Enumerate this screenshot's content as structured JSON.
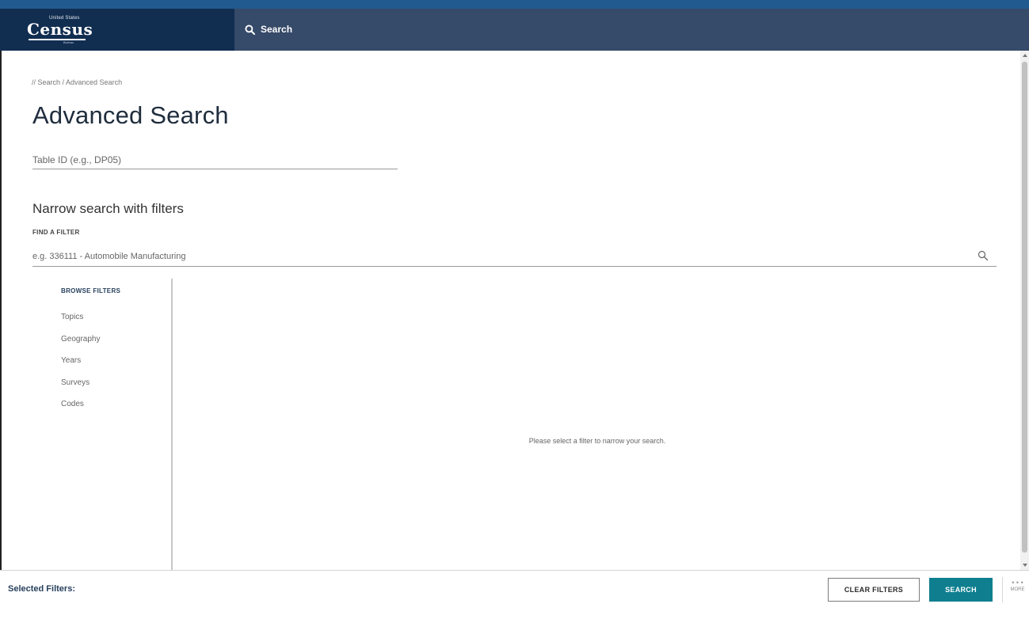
{
  "header": {
    "logo": {
      "sup": "United States",
      "word": "Census",
      "sub": "Bureau"
    },
    "search_label": "Search"
  },
  "breadcrumb": "// Search / Advanced Search",
  "page_title": "Advanced Search",
  "table_id": {
    "placeholder": "Table ID (e.g., DP05)",
    "value": ""
  },
  "narrow_heading": "Narrow search with filters",
  "find_filter": {
    "label": "FIND A FILTER",
    "placeholder": "e.g. 336111 - Automobile Manufacturing",
    "value": ""
  },
  "browse": {
    "title": "BROWSE FILTERS",
    "items": [
      {
        "label": "Topics"
      },
      {
        "label": "Geography"
      },
      {
        "label": "Years"
      },
      {
        "label": "Surveys"
      },
      {
        "label": "Codes"
      }
    ]
  },
  "empty_message": "Please select a filter to narrow your search.",
  "footer": {
    "selected_label": "Selected Filters:",
    "clear_label": "CLEAR FILTERS",
    "search_label": "SEARCH",
    "more_dots": "• • •",
    "more_label": "MORE"
  },
  "colors": {
    "top_strip": "#215a8e",
    "header": "#364a69",
    "logo_bg": "#112e51",
    "search_button": "#0f7f8f",
    "heading_navy": "#263f5c"
  }
}
